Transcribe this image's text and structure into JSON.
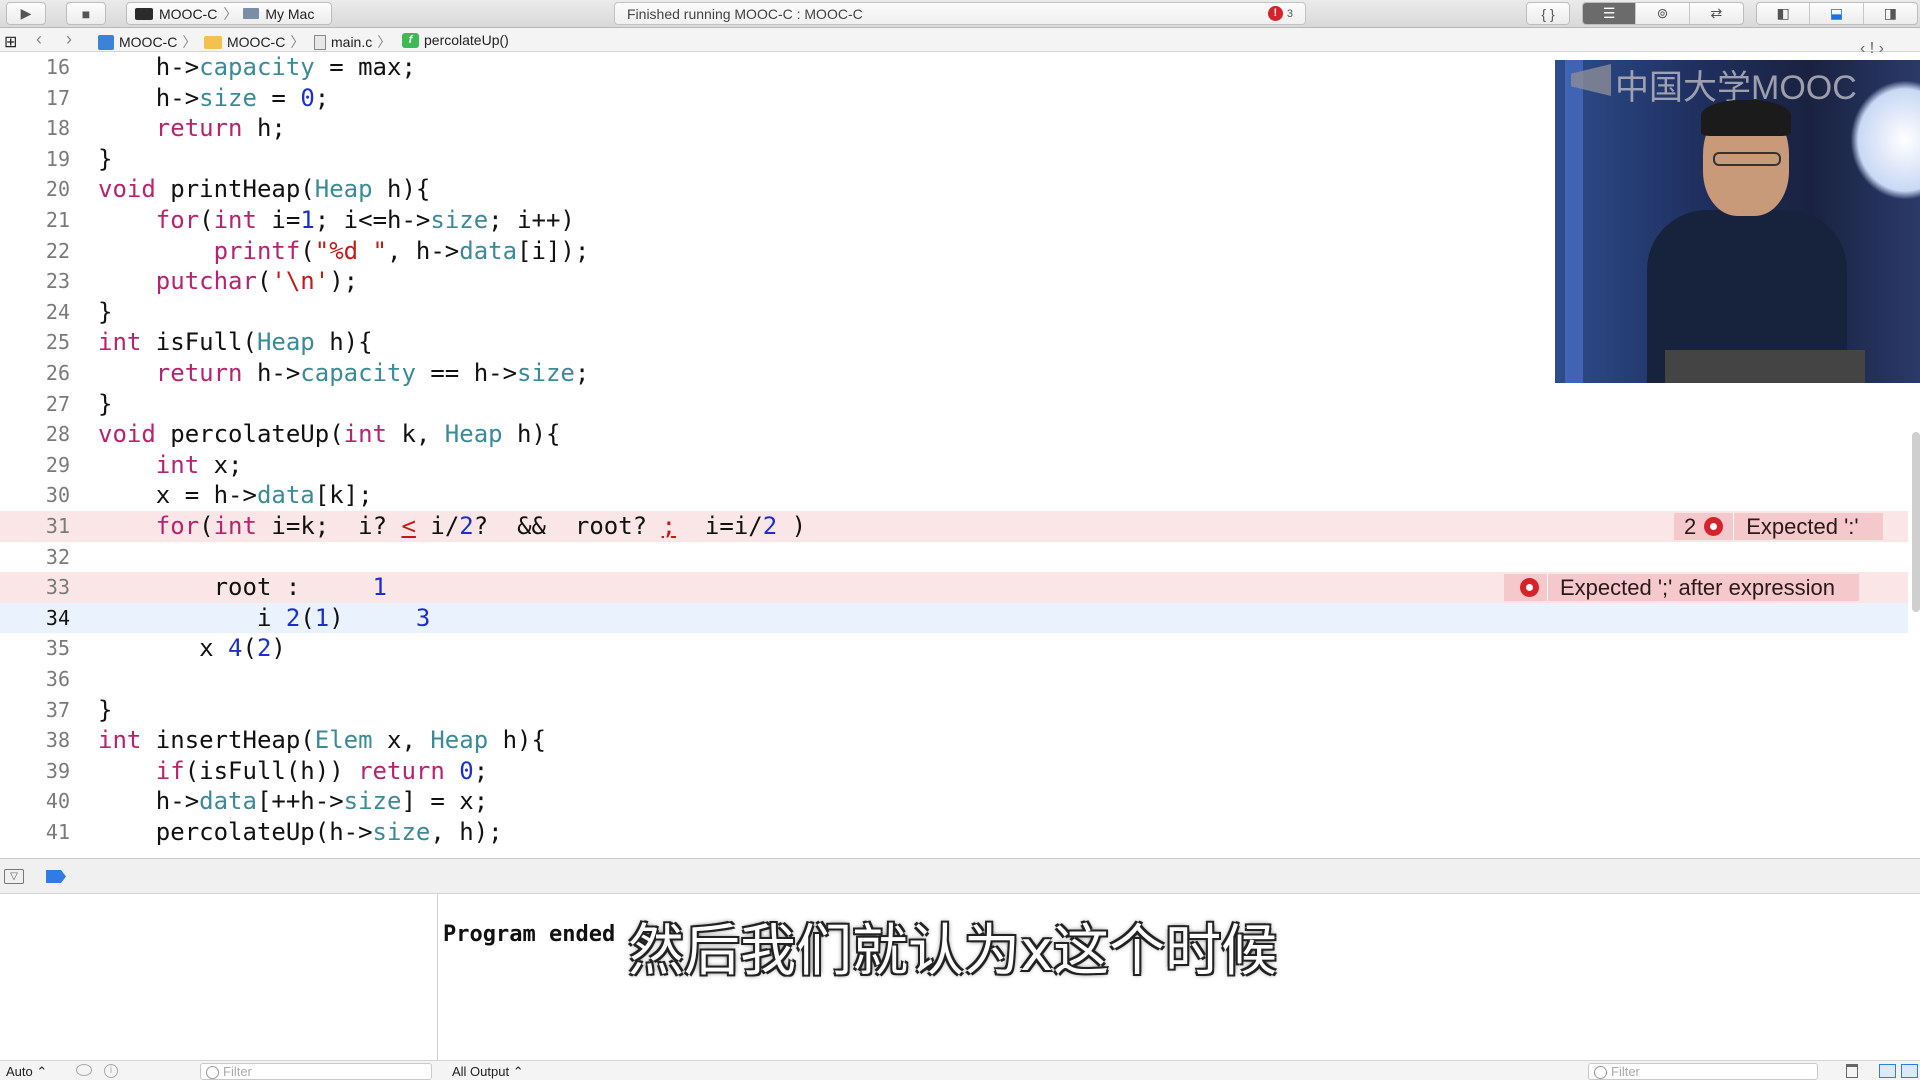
{
  "toolbar": {
    "run_icon": "play-icon",
    "stop_icon": "stop-icon",
    "scheme": "MOOC-C",
    "scheme_sep": "〉",
    "destination": "My Mac",
    "status": "Finished running MOOC-C : MOOC-C",
    "error_count": "3",
    "error_glyph": "!"
  },
  "jumpbar": {
    "project": "MOOC-C",
    "folder": "MOOC-C",
    "file": "main.c",
    "function": "percolateUp()",
    "function_glyph": "f"
  },
  "editor": {
    "lines": [
      {
        "n": "16"
      },
      {
        "n": "17"
      },
      {
        "n": "18"
      },
      {
        "n": "19"
      },
      {
        "n": "20"
      },
      {
        "n": "21"
      },
      {
        "n": "22"
      },
      {
        "n": "23"
      },
      {
        "n": "24"
      },
      {
        "n": "25"
      },
      {
        "n": "26"
      },
      {
        "n": "27"
      },
      {
        "n": "28"
      },
      {
        "n": "29"
      },
      {
        "n": "30"
      },
      {
        "n": "31"
      },
      {
        "n": "32"
      },
      {
        "n": "33"
      },
      {
        "n": "34"
      },
      {
        "n": "35"
      },
      {
        "n": "36"
      },
      {
        "n": "37"
      },
      {
        "n": "38"
      },
      {
        "n": "39"
      },
      {
        "n": "40"
      },
      {
        "n": "41"
      }
    ],
    "errors": {
      "line31": {
        "count": "2",
        "message": "Expected ':'"
      },
      "line33": {
        "message": "Expected ';' after expression"
      }
    }
  },
  "video": {
    "logo_text": "中国大学MOOC",
    "nav": "‹ ! ›"
  },
  "console": {
    "output": "Program ended",
    "subtitle": "然后我们就认为x这个时候"
  },
  "bottombar": {
    "auto": "Auto ⌃",
    "filter_placeholder": "Filter",
    "output_selector": "All Output ⌃",
    "console_filter_placeholder": "Filter"
  },
  "colors": {
    "keyword": "#b7236e",
    "number": "#1b2fd1",
    "string": "#c41a16",
    "type": "#3b8a97",
    "error_line": "#fbe6e7",
    "current_line": "#eaf2fd"
  }
}
